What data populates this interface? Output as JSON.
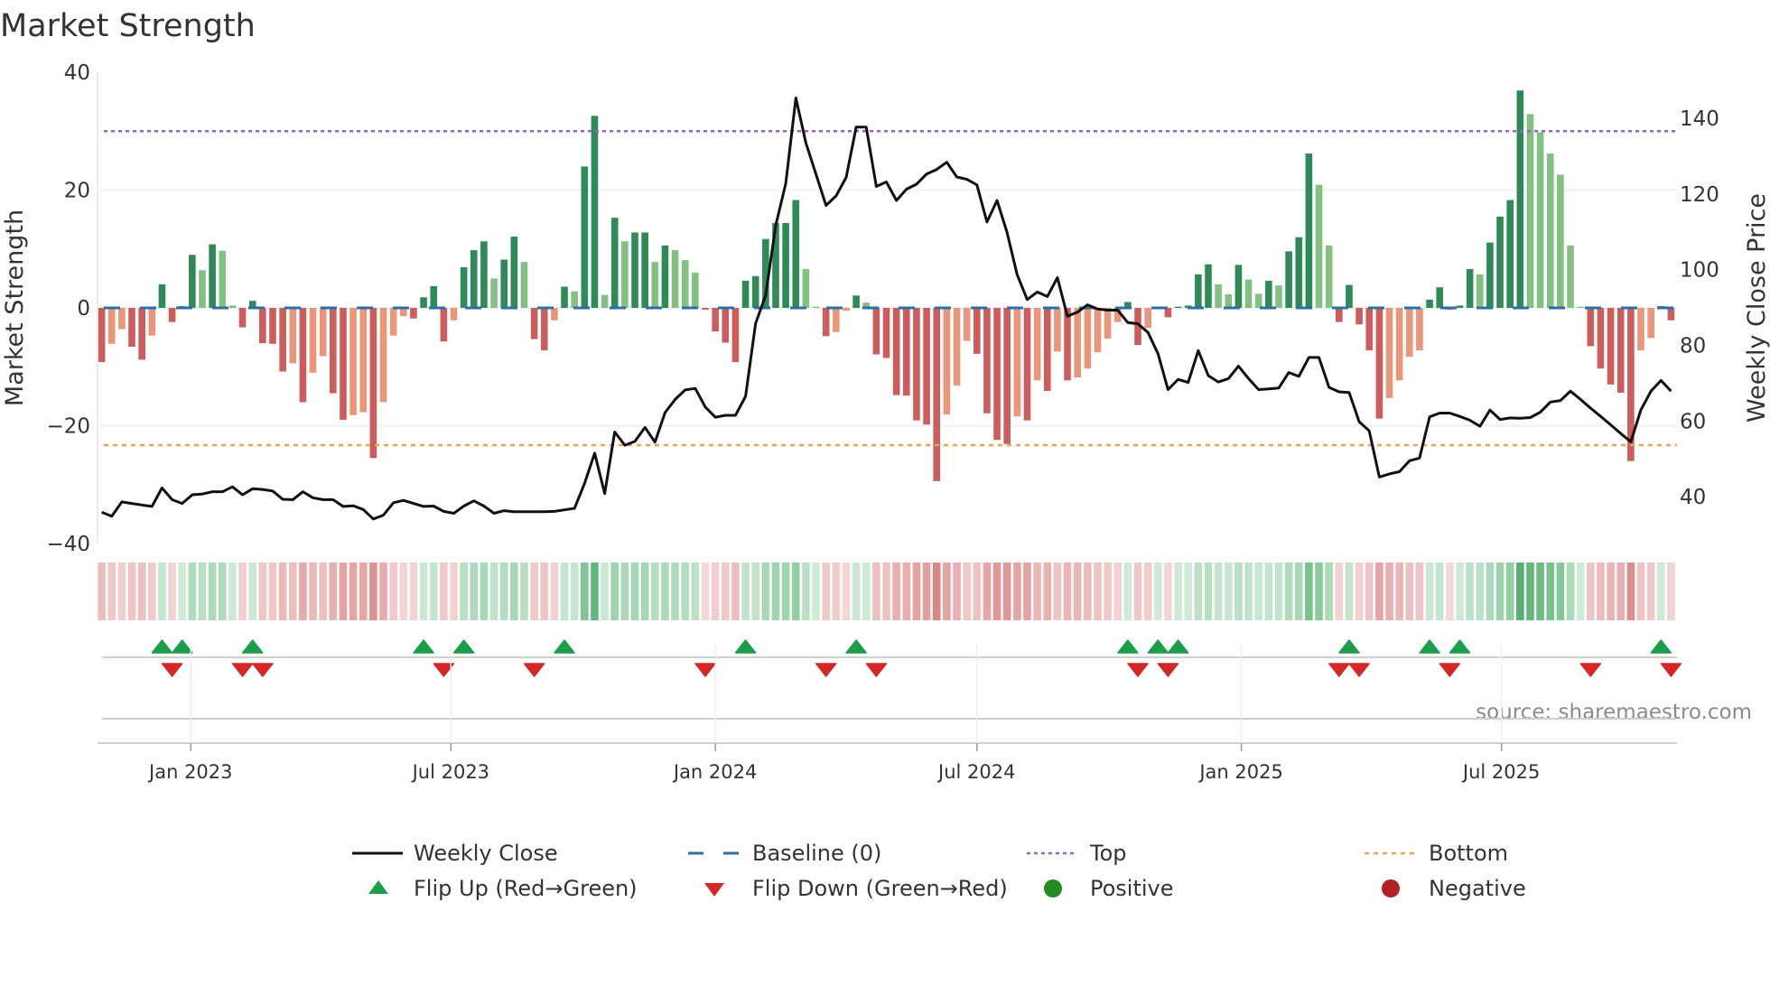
{
  "chart_data": {
    "type": "bar",
    "title": "Market Strength",
    "ylabel": "Market Strength",
    "y2label": "Weekly Close Price",
    "ylim": [
      -40,
      40
    ],
    "y2lim": [
      27.6,
      152.2
    ],
    "yticks": [
      40,
      20,
      0,
      -20,
      -40
    ],
    "ytick_labels": [
      "40",
      "20",
      "0",
      "−20",
      "−40"
    ],
    "y2ticks": [
      140,
      120,
      100,
      80,
      60,
      40
    ],
    "x_start": "2022-10-31",
    "x_step_days": 7,
    "xticks": [
      {
        "date": "2023-01-01",
        "label": "Jan 2023"
      },
      {
        "date": "2023-07-01",
        "label": "Jul 2023"
      },
      {
        "date": "2024-01-01",
        "label": "Jan 2024"
      },
      {
        "date": "2024-07-01",
        "label": "Jul 2024"
      },
      {
        "date": "2025-01-01",
        "label": "Jan 2025"
      },
      {
        "date": "2025-07-01",
        "label": "Jul 2025"
      }
    ],
    "top_level": 30,
    "bottom_level": -23.3,
    "baseline": 0,
    "grid": true,
    "series": [
      {
        "name": "Market Strength",
        "type": "bar",
        "values": [
          -9.2,
          -6.1,
          -3.6,
          -6.6,
          -8.8,
          -4.7,
          4.0,
          -2.4,
          0.3,
          9.0,
          6.4,
          10.8,
          9.7,
          0.4,
          -3.3,
          1.2,
          -6.0,
          -6.1,
          -10.8,
          -9.4,
          -16.0,
          -11.0,
          -8.2,
          -14.5,
          -19.0,
          -18.2,
          -17.7,
          -25.5,
          -16.0,
          -4.7,
          -1.4,
          -1.8,
          1.8,
          3.7,
          -5.7,
          -2.1,
          6.9,
          9.8,
          11.3,
          5.0,
          8.2,
          12.1,
          7.8,
          -5.3,
          -7.2,
          -2.1,
          3.6,
          2.8,
          24.0,
          32.6,
          2.2,
          15.3,
          11.3,
          12.8,
          12.8,
          7.8,
          10.6,
          9.8,
          8.1,
          6.0,
          -0.3,
          -4.0,
          -5.9,
          -9.2,
          4.6,
          5.4,
          11.7,
          14.4,
          14.4,
          18.3,
          6.6,
          0.2,
          -4.8,
          -4.1,
          -0.5,
          2.1,
          0.9,
          -7.9,
          -8.5,
          -14.8,
          -14.9,
          -19.1,
          -19.8,
          -29.4,
          -18.1,
          -13.2,
          -5.6,
          -7.8,
          -17.9,
          -22.4,
          -23.1,
          -18.4,
          -19.1,
          -12.3,
          -14.1,
          -7.4,
          -12.3,
          -11.8,
          -10.3,
          -7.5,
          -5.2,
          -2.4,
          1.0,
          -6.3,
          -3.4,
          0.2,
          -1.6,
          0.2,
          0.4,
          5.7,
          7.4,
          4.0,
          2.3,
          7.3,
          4.8,
          2.4,
          4.6,
          3.8,
          9.6,
          12.0,
          26.2,
          20.9,
          10.6,
          -2.4,
          3.9,
          -2.8,
          -7.2,
          -18.8,
          -15.3,
          -12.3,
          -8.3,
          -7.2,
          1.4,
          3.5,
          -0.3,
          0.4,
          6.6,
          5.7,
          11.1,
          15.5,
          18.3,
          36.9,
          32.9,
          29.8,
          26.2,
          22.6,
          10.6,
          0.2,
          -6.5,
          -10.3,
          -13.0,
          -14.4,
          -26.0,
          -7.2,
          -5.1,
          0.3,
          -2.1
        ]
      },
      {
        "name": "Weekly Close",
        "type": "line",
        "axis": "right",
        "values": [
          35.9,
          34.8,
          38.6,
          38.2,
          37.8,
          37.4,
          42.3,
          39.2,
          38.2,
          40.5,
          40.7,
          41.3,
          41.3,
          42.6,
          40.5,
          42.1,
          41.9,
          41.5,
          39.3,
          39.2,
          41.3,
          39.7,
          39.2,
          39.2,
          37.4,
          37.6,
          36.6,
          34.1,
          35.1,
          38.4,
          39.0,
          38.2,
          37.4,
          37.5,
          36.1,
          35.6,
          37.5,
          38.9,
          37.5,
          35.6,
          36.3,
          36.0,
          36.0,
          36.0,
          36.0,
          36.1,
          36.5,
          36.9,
          43.5,
          51.5,
          40.8,
          57.1,
          53.6,
          54.6,
          58.3,
          54.4,
          62.2,
          65.7,
          68.2,
          68.6,
          63.7,
          61.0,
          61.5,
          61.5,
          66.5,
          85.8,
          93.2,
          111.7,
          122.8,
          145.4,
          133.5,
          125.3,
          117.0,
          119.5,
          124.4,
          137.7,
          137.7,
          122.0,
          123.2,
          118.3,
          121.3,
          122.6,
          125.3,
          126.5,
          128.4,
          124.5,
          123.9,
          122.4,
          112.6,
          118.3,
          109.8,
          98.7,
          92.1,
          94.1,
          92.9,
          97.9,
          87.7,
          88.8,
          90.7,
          89.6,
          89.3,
          89.3,
          86.0,
          85.7,
          83.4,
          77.8,
          68.3,
          71.0,
          70.2,
          78.6,
          72.0,
          70.3,
          71.2,
          74.5,
          71.2,
          68.3,
          68.5,
          68.7,
          72.8,
          71.8,
          76.8,
          76.8,
          68.9,
          67.7,
          67.5,
          59.8,
          57.4,
          45.2,
          46.0,
          46.6,
          49.5,
          50.2,
          61.1,
          62.1,
          62.1,
          61.2,
          60.2,
          58.6,
          62.9,
          60.4,
          60.8,
          60.7,
          60.9,
          62.3,
          65.0,
          65.4,
          67.9,
          65.7,
          63.4,
          61.2,
          59.0,
          56.7,
          54.5,
          62.9,
          67.9,
          70.7,
          67.9
        ]
      }
    ],
    "flip_up_weeks": [
      7,
      9,
      16,
      33,
      37,
      47,
      65,
      76,
      103,
      106,
      108,
      125,
      133,
      136,
      156
    ],
    "flip_down_weeks": [
      8,
      15,
      17,
      35,
      44,
      61,
      73,
      78,
      104,
      107,
      124,
      126,
      135,
      149,
      157
    ],
    "legend": {
      "placement": "bottom",
      "items": [
        {
          "key": "close",
          "label": "Weekly Close"
        },
        {
          "key": "baseline",
          "label": "Baseline (0)"
        },
        {
          "key": "top",
          "label": "Top"
        },
        {
          "key": "bottom",
          "label": "Bottom"
        },
        {
          "key": "flip_up",
          "label": "Flip Up (Red→Green)"
        },
        {
          "key": "flip_down",
          "label": "Flip Down (Green→Red)"
        },
        {
          "key": "positive",
          "label": "Positive"
        },
        {
          "key": "negative",
          "label": "Negative"
        }
      ]
    },
    "annotation": "source: sharemaestro.com",
    "colors": {
      "pos_strong": "#2e8b57",
      "pos_weak": "#82c182",
      "neg_strong": "#cd5c5c",
      "neg_weak": "#e9967a",
      "baseline": "#2a6fa8",
      "top": "#9b5fd6",
      "bottom": "#f0a05a",
      "close": "#111111",
      "flip_up": "#1a9e4a",
      "flip_down": "#d62728",
      "positive_dot": "#228b22",
      "negative_dot": "#b22222"
    }
  }
}
